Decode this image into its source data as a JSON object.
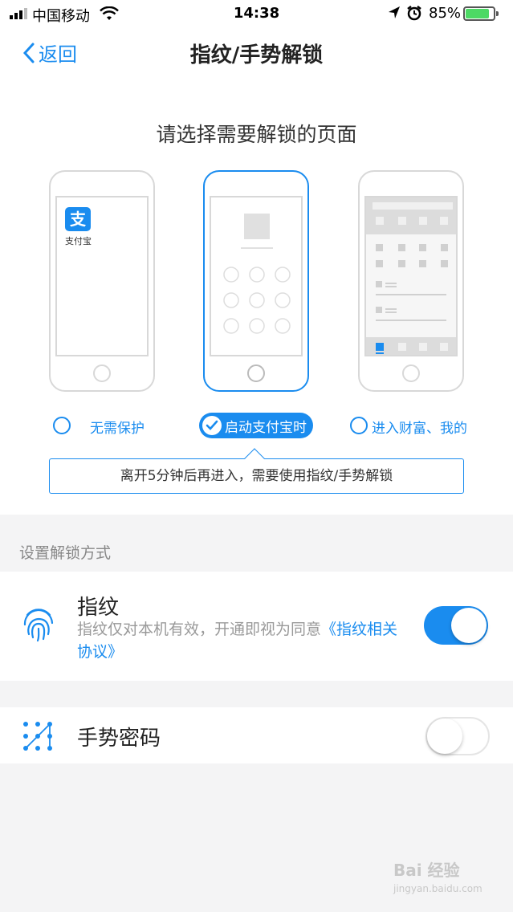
{
  "status": {
    "carrier": "中国移动",
    "time": "14:38",
    "battery": "85%",
    "battery_level": 0.85
  },
  "nav": {
    "back_label": "返回",
    "title": "指纹/手势解锁"
  },
  "selector": {
    "heading": "请选择需要解锁的页面",
    "app_name": "支付宝",
    "app_logo_char": "支",
    "options": [
      {
        "label": "无需保护",
        "selected": false
      },
      {
        "label": "启动支付宝时",
        "selected": true
      },
      {
        "label": "进入财富、我的",
        "selected": false
      }
    ],
    "hint": "离开5分钟后再进入，需要使用指纹/手势解锁"
  },
  "section_label": "设置解锁方式",
  "methods": {
    "fingerprint": {
      "title": "指纹",
      "desc": "指纹仅对本机有效，开通即视为同意",
      "link": "《指纹相关协议》",
      "enabled": true
    },
    "gesture": {
      "title": "手势密码",
      "enabled": false
    }
  },
  "watermark": {
    "text": "Bai 经验",
    "sub": "jingyan.baidu.com"
  },
  "colors": {
    "accent": "#1a8cef",
    "background": "#f4f4f5"
  }
}
